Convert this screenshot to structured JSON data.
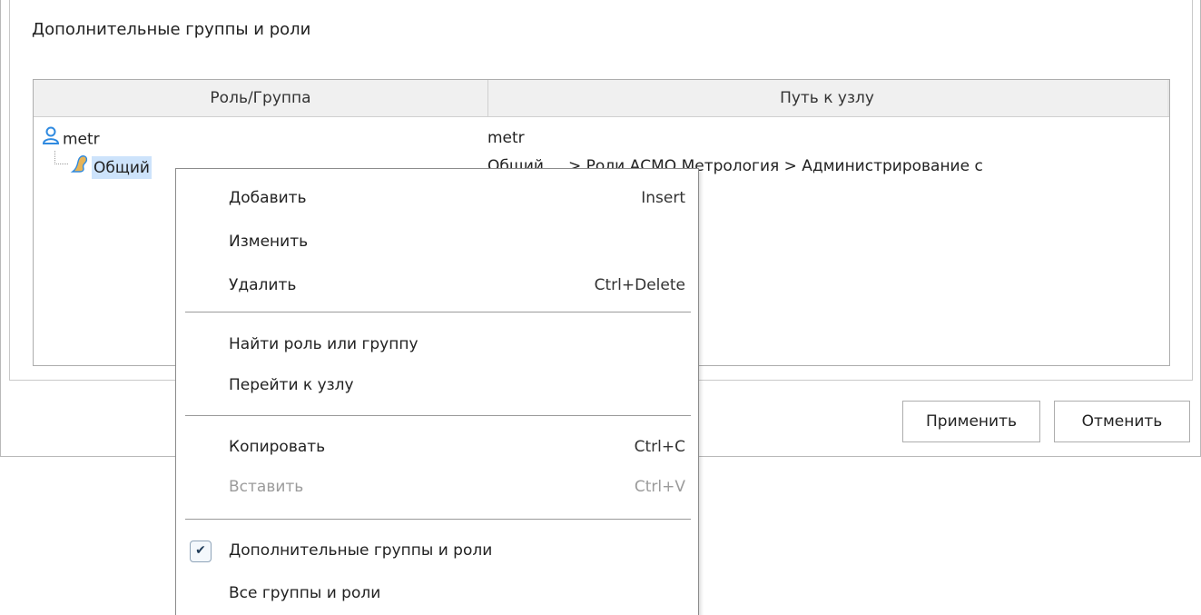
{
  "section": {
    "title": "Дополнительные группы и роли"
  },
  "table": {
    "columns": [
      "Роль/Группа",
      "Путь к узлу"
    ],
    "rows": [
      {
        "name": "metr",
        "path": "metr",
        "icon": "user-icon"
      },
      {
        "name": "Общий",
        "path": "Общий ... > Роли АСМО Метрология > Администрирование с",
        "icon": "role-icon"
      }
    ]
  },
  "buttons": {
    "apply": "Применить",
    "cancel": "Отменить"
  },
  "menu": {
    "items": [
      {
        "label": "Добавить",
        "shortcut": "Insert"
      },
      {
        "label": "Изменить",
        "shortcut": ""
      },
      {
        "label": "Удалить",
        "shortcut": "Ctrl+Delete"
      },
      {
        "label": "Найти роль или группу",
        "shortcut": ""
      },
      {
        "label": "Перейти к узлу",
        "shortcut": ""
      },
      {
        "label": "Копировать",
        "shortcut": "Ctrl+C"
      },
      {
        "label": "Вставить",
        "shortcut": "Ctrl+V",
        "disabled": true
      },
      {
        "label": "Дополнительные группы и роли",
        "shortcut": "",
        "checked": true
      },
      {
        "label": "Все группы и роли",
        "shortcut": ""
      }
    ]
  },
  "colors": {
    "selection": "#cde3fb",
    "user_icon": "#2f8ae0",
    "role_icon": "#e7b457"
  }
}
